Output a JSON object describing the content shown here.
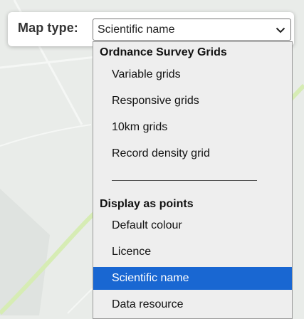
{
  "control": {
    "label": "Map type:",
    "selected_value": "Scientific name"
  },
  "dropdown": {
    "groups": [
      {
        "header": "Ordnance Survey Grids",
        "options": [
          "Variable grids",
          "Responsive grids",
          "10km grids",
          "Record density grid"
        ]
      },
      {
        "header": "Display as points",
        "options": [
          "Default colour",
          "Licence",
          "Scientific name",
          "Data resource"
        ]
      }
    ],
    "selected_option": "Scientific name"
  },
  "colors": {
    "selection": "#1967d2",
    "map_background": "#e9ece9",
    "map_green_road": "#d6ecb4"
  },
  "icons": {
    "select_arrow": "chevron-down-icon"
  }
}
